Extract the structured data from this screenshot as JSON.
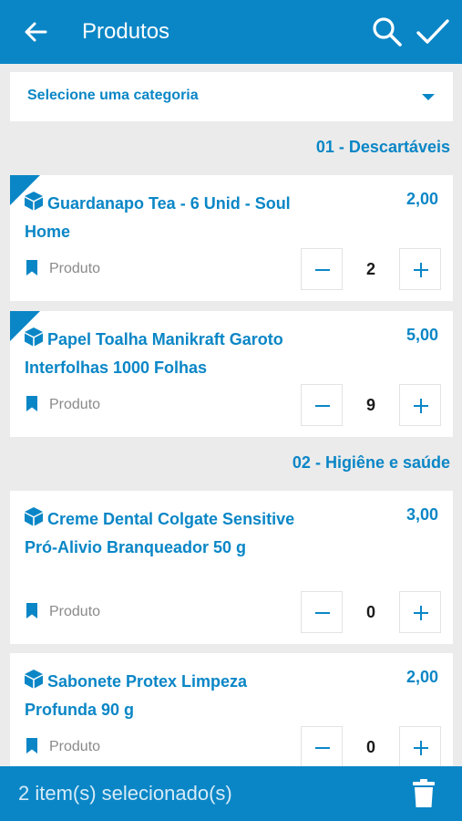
{
  "header": {
    "title": "Produtos",
    "back_icon": "arrow-left-icon",
    "search_icon": "search-icon",
    "confirm_icon": "check-icon",
    "color": "#0a86c6"
  },
  "category_select": {
    "label": "Selecione uma categoria",
    "icon": "caret-down-icon"
  },
  "sections": [
    {
      "title": "01 - Descartáveis",
      "products": [
        {
          "name": "Guardanapo Tea - 6 Unid - Soul Home",
          "price": "2,00",
          "type": "Produto",
          "quantity": "2",
          "selected": true
        },
        {
          "name": "Papel Toalha Manikraft Garoto Interfolhas 1000 Folhas",
          "price": "5,00",
          "type": "Produto",
          "quantity": "9",
          "selected": true
        }
      ]
    },
    {
      "title": "02 - Higiêne e saúde",
      "products": [
        {
          "name": "Creme Dental Colgate Sensitive Pró-Alivio Branqueador 50 g",
          "price": "3,00",
          "type": "Produto",
          "quantity": "0",
          "selected": false
        },
        {
          "name": "Sabonete Protex Limpeza Profunda 90 g",
          "price": "2,00",
          "type": "Produto",
          "quantity": "0",
          "selected": false
        }
      ]
    }
  ],
  "footer": {
    "selected_text": "2 item(s) selecionado(s)",
    "trash_icon": "trash-icon"
  }
}
